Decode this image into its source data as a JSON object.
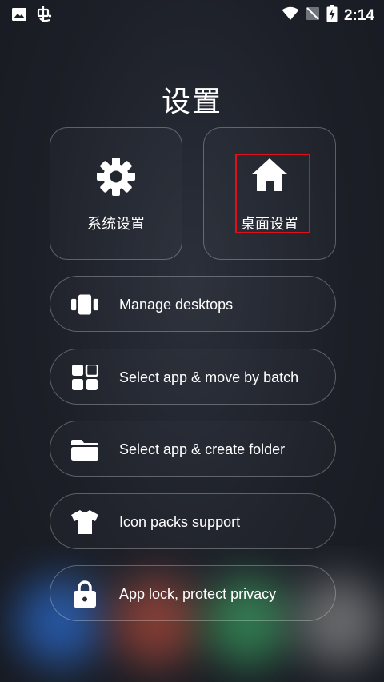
{
  "status_bar": {
    "left_icons": [
      "image-icon",
      "bug-app-icon"
    ],
    "right_icons": [
      "wifi-icon",
      "no-signal-icon",
      "battery-charging-icon"
    ],
    "time": "2:14"
  },
  "title": "设置",
  "cards": [
    {
      "label": "系统设置",
      "icon": "gear-icon"
    },
    {
      "label": "桌面设置",
      "icon": "home-icon",
      "highlighted": true
    }
  ],
  "options": [
    {
      "label": "Manage desktops",
      "icon": "desktops-icon"
    },
    {
      "label": "Select app & move by batch",
      "icon": "grid-apps-icon"
    },
    {
      "label": "Select app & create folder",
      "icon": "folder-icon"
    },
    {
      "label": "Icon packs support",
      "icon": "tshirt-icon"
    },
    {
      "label": "App lock, protect privacy",
      "icon": "lock-icon"
    }
  ],
  "colors": {
    "highlight": "#e0101a",
    "background": "#1c1f27"
  }
}
